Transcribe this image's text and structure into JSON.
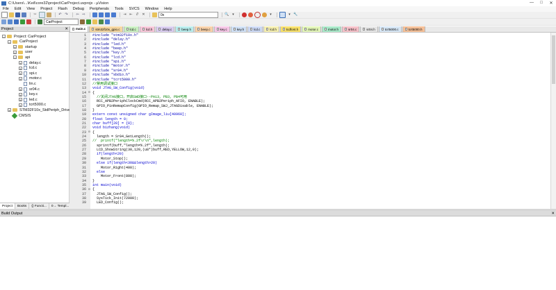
{
  "window": {
    "title": "C:\\Users\\...\\Keil\\core32\\project\\CarProject.uvprojx - µVision",
    "controls": [
      "—",
      "□",
      "✕"
    ]
  },
  "menu": [
    "File",
    "Edit",
    "View",
    "Project",
    "Flash",
    "Debug",
    "Peripherals",
    "Tools",
    "SVCS",
    "Window",
    "Help"
  ],
  "toolbar": {
    "find_combo": "0x",
    "target_combo": "CarProject"
  },
  "project_pane": {
    "header": "Project",
    "close": "✕",
    "tree": [
      {
        "label": "Project: CarProject",
        "level": 0,
        "kind": "root",
        "expander": "−"
      },
      {
        "label": "CarProject",
        "level": 1,
        "kind": "folder",
        "expander": "−"
      },
      {
        "label": "startup",
        "level": 2,
        "kind": "folder",
        "expander": "+"
      },
      {
        "label": "user",
        "level": 2,
        "kind": "folder",
        "expander": "+"
      },
      {
        "label": "api",
        "level": 2,
        "kind": "folder",
        "expander": "−"
      },
      {
        "label": "delay.c",
        "level": 3,
        "kind": "file",
        "expander": "+"
      },
      {
        "label": "lcd.c",
        "level": 3,
        "kind": "file",
        "expander": "+"
      },
      {
        "label": "spi.c",
        "level": 3,
        "kind": "file",
        "expander": "+"
      },
      {
        "label": "motor.c",
        "level": 3,
        "kind": "file",
        "expander": "+"
      },
      {
        "label": "lin.c",
        "level": 3,
        "kind": "file",
        "expander": ""
      },
      {
        "label": "sr04.c",
        "level": 3,
        "kind": "file",
        "expander": "+"
      },
      {
        "label": "key.c",
        "level": 3,
        "kind": "file",
        "expander": "+"
      },
      {
        "label": "led.c",
        "level": 3,
        "kind": "file",
        "expander": "+"
      },
      {
        "label": "tcrt5000.c",
        "level": 3,
        "kind": "file",
        "expander": "+"
      },
      {
        "label": "STM32F10x_StdPeriph_Driver",
        "level": 1,
        "kind": "folder",
        "expander": "+"
      },
      {
        "label": "CMSIS",
        "level": 1,
        "kind": "gear",
        "expander": ""
      }
    ],
    "bottom_tabs": [
      "Project",
      "Books",
      "{} Functi...",
      "0→ Templ..."
    ]
  },
  "file_tabs": [
    {
      "label": "main.c",
      "color": "#ffffff",
      "active": true
    },
    {
      "label": "stm32f10x_gpio.c",
      "color": "#f5d6a0",
      "active": false
    },
    {
      "label": "lcd.c",
      "color": "#c8efc0",
      "active": false
    },
    {
      "label": "lcd.h",
      "color": "#f7c6d8",
      "active": false
    },
    {
      "label": "delay.c",
      "color": "#d9ccef",
      "active": false
    },
    {
      "label": "beep.h",
      "color": "#b8ecec",
      "active": false
    },
    {
      "label": "beep.c",
      "color": "#f7d0a8",
      "active": false
    },
    {
      "label": "key.c",
      "color": "#f5c6e6",
      "active": false
    },
    {
      "label": "key.h",
      "color": "#cfe0f5",
      "active": false
    },
    {
      "label": "lcd.c",
      "color": "#ccd9f5",
      "active": false
    },
    {
      "label": "lcd.h",
      "color": "#f5efb0",
      "active": false
    },
    {
      "label": "tcdfont.h",
      "color": "#f7e06a",
      "active": false
    },
    {
      "label": "motor.c",
      "color": "#e2f5b8",
      "active": false
    },
    {
      "label": "motor.h",
      "color": "#a8e8c8",
      "active": false
    },
    {
      "label": "sr04.c",
      "color": "#f5c0c8",
      "active": false
    },
    {
      "label": "sr04.h",
      "color": "#e6e6e6",
      "active": false
    },
    {
      "label": "tcrt5000.c",
      "color": "#d6e6f5",
      "active": false
    },
    {
      "label": "tcrt5000.h",
      "color": "#f5c098",
      "active": false
    }
  ],
  "code_lines": [
    {
      "n": "1",
      "fold": "",
      "text": "#include \"stm32f10x.h\"",
      "style": "pp"
    },
    {
      "n": "2",
      "fold": "",
      "text": "#include \"delay.h\"",
      "style": "pp"
    },
    {
      "n": "3",
      "fold": "",
      "text": "#include \"led.h\"",
      "style": "pp"
    },
    {
      "n": "4",
      "fold": "",
      "text": "#include \"beep.h\"",
      "style": "pp"
    },
    {
      "n": "5",
      "fold": "",
      "text": "#include \"key.h\"",
      "style": "pp"
    },
    {
      "n": "6",
      "fold": "",
      "text": "#include \"lcd.h\"",
      "style": "pp"
    },
    {
      "n": "7",
      "fold": "",
      "text": "#include \"spi.h\"",
      "style": "pp"
    },
    {
      "n": "8",
      "fold": "",
      "text": "#include \"motor.h\"",
      "style": "pp"
    },
    {
      "n": "9",
      "fold": "",
      "text": "#include \"sr04.h\"",
      "style": "pp"
    },
    {
      "n": "10",
      "fold": "",
      "text": "#include \"sbdio.h\"",
      "style": "pp"
    },
    {
      "n": "11",
      "fold": "",
      "text": "#include \"tcrt5000.h\"",
      "style": "pp"
    },
    {
      "n": "12",
      "fold": "",
      "text": "//禁用调试接口",
      "style": "cm"
    },
    {
      "n": "13",
      "fold": "",
      "text": "void JTAG_SW_Config(void)",
      "style": "kw"
    },
    {
      "n": "14",
      "fold": "⊟",
      "text": "{",
      "style": "hl"
    },
    {
      "n": "15",
      "fold": "",
      "text": "  //关闭JTAG接口，开启SWD接口--PA13, PB3, PB4可用",
      "style": "cm"
    },
    {
      "n": "16",
      "fold": "",
      "text": "  RCC_APB2PeriphClockCmd(RCC_APB2Periph_AFIO, ENABLE);",
      "style": "hl"
    },
    {
      "n": "17",
      "fold": "",
      "text": "  GPIO_PinRemapConfig(GPIO_Remap_SWJ_JTAGDisable, ENABLE);",
      "style": "hl"
    },
    {
      "n": "18",
      "fold": "",
      "text": "}",
      "style": "hl"
    },
    {
      "n": "19",
      "fold": "",
      "text": "extern const unsigned char gImage_liu[40960];",
      "style": "kw"
    },
    {
      "n": "20",
      "fold": "",
      "text": "float length = 0;",
      "style": "kw"
    },
    {
      "n": "21",
      "fold": "",
      "text": "char buff[20] = {0};",
      "style": "kw"
    },
    {
      "n": "22",
      "fold": "",
      "text": "void bizhang(void)",
      "style": "kw"
    },
    {
      "n": "23",
      "fold": "⊟",
      "text": "{",
      "style": "hl"
    },
    {
      "n": "24",
      "fold": "",
      "text": "  length = Sr04_GetLength();",
      "style": "hl"
    },
    {
      "n": "25",
      "fold": "",
      "text": "//  printf(\"length=%.2f\\r\\n\",length);",
      "style": "cm"
    },
    {
      "n": "26",
      "fold": "",
      "text": "  sprintf(buff,\"length=%.2f\",length);",
      "style": "hl"
    },
    {
      "n": "27",
      "fold": "",
      "text": "  LCD_ShowString(30,120,(u8*)buff,RED,YELLOW,12,0);",
      "style": "hl"
    },
    {
      "n": "28",
      "fold": "",
      "text": "  if(length<20)",
      "style": "kw"
    },
    {
      "n": "29",
      "fold": "",
      "text": "    Motor_Stop();",
      "style": "hl"
    },
    {
      "n": "30",
      "fold": "",
      "text": "  else if(length<30&&length>20)",
      "style": "kw"
    },
    {
      "n": "31",
      "fold": "",
      "text": "    Motor_Right(400);",
      "style": "hl"
    },
    {
      "n": "32",
      "fold": "",
      "text": "  else",
      "style": "kw"
    },
    {
      "n": "33",
      "fold": "",
      "text": "    Motor_Front(800);",
      "style": "hl"
    },
    {
      "n": "34",
      "fold": "",
      "text": "}",
      "style": "hl"
    },
    {
      "n": "35",
      "fold": "",
      "text": "int main(void)",
      "style": "kw"
    },
    {
      "n": "36",
      "fold": "⊟",
      "text": "{",
      "style": "hl"
    },
    {
      "n": "37",
      "fold": "",
      "text": "  JTAG_SW_Config();",
      "style": "hl"
    },
    {
      "n": "38",
      "fold": "",
      "text": "  SysTick_Init(72000);",
      "style": "hl"
    },
    {
      "n": "39",
      "fold": "",
      "text": "  LED_Config();",
      "style": "hl"
    }
  ],
  "build_output": {
    "header": "Build Output",
    "close": "✕"
  },
  "colors": {
    "accent": "#3b6fb6",
    "comment": "#008000",
    "keyword": "#0000d0",
    "preprocessor": "#0000a0"
  }
}
